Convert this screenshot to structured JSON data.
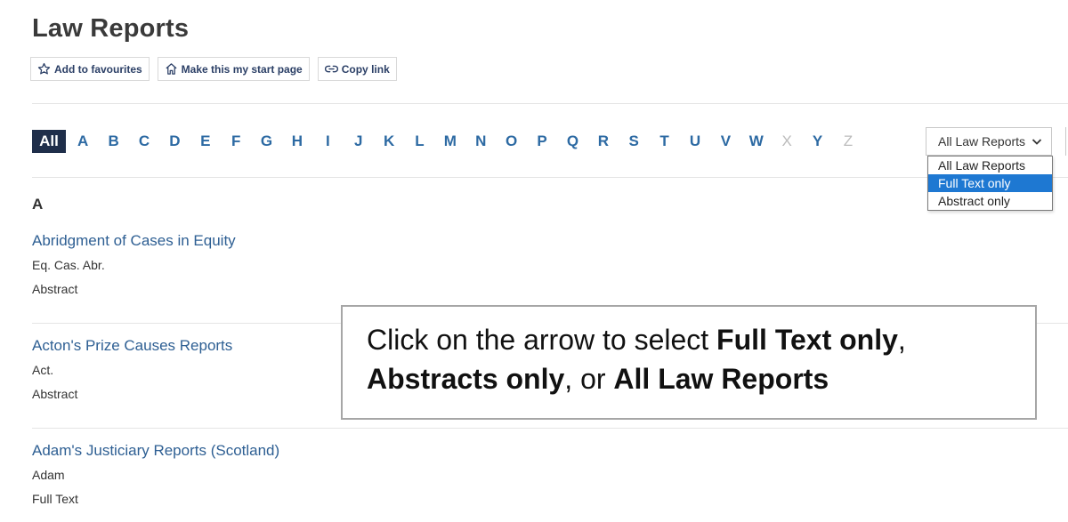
{
  "page": {
    "title": "Law Reports"
  },
  "toolbar": {
    "favourites_label": "Add to favourites",
    "start_page_label": "Make this my start page",
    "copy_link_label": "Copy link"
  },
  "alphabet": {
    "all_label": "All",
    "letters": [
      "A",
      "B",
      "C",
      "D",
      "E",
      "F",
      "G",
      "H",
      "I",
      "J",
      "K",
      "L",
      "M",
      "N",
      "O",
      "P",
      "Q",
      "R",
      "S",
      "T",
      "U",
      "V",
      "W",
      "X",
      "Y",
      "Z"
    ],
    "disabled": [
      "X",
      "Z"
    ]
  },
  "filter": {
    "selected": "All Law Reports",
    "options": [
      "All Law Reports",
      "Full Text only",
      "Abstract only"
    ],
    "highlighted": "Full Text only"
  },
  "section": {
    "letter": "A"
  },
  "entries": [
    {
      "title": "Abridgment of Cases in Equity",
      "abbr": "Eq. Cas. Abr.",
      "type": "Abstract"
    },
    {
      "title": "Acton's Prize Causes Reports",
      "abbr": "Act.",
      "type": "Abstract"
    },
    {
      "title": "Adam's Justiciary Reports (Scotland)",
      "abbr": "Adam",
      "type": "Full Text"
    }
  ],
  "callout": {
    "line1_prefix": "Click on the arrow to select ",
    "bold1": "Full Text only",
    "sep1": ",",
    "bold2": "Abstracts only",
    "sep2": ", or ",
    "bold3": "All Law Reports"
  },
  "colors": {
    "accent_navy": "#1f2e4a",
    "link_blue": "#2e5f93",
    "highlight": "#1e78d2"
  }
}
